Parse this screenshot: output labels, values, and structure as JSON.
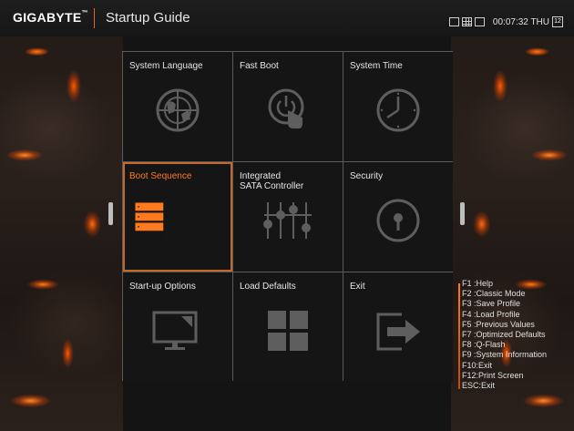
{
  "header": {
    "brand": "GIGABYTE",
    "brand_mark": "™",
    "title": "Startup Guide",
    "time": "00:07:32 THU",
    "calendar_day": "12"
  },
  "tiles": [
    {
      "label": "System Language",
      "icon": "globe-icon"
    },
    {
      "label": "Fast Boot",
      "icon": "power-touch-icon"
    },
    {
      "label": "System Time",
      "icon": "clock-icon"
    },
    {
      "label": "Boot Sequence",
      "icon": "boot-list-icon",
      "selected": true,
      "boot_items": [
        "1",
        "2",
        "3"
      ]
    },
    {
      "label": "Integrated\nSATA Controller",
      "icon": "sliders-icon"
    },
    {
      "label": "Security",
      "icon": "keyhole-icon"
    },
    {
      "label": "Start-up Options",
      "icon": "monitor-icon"
    },
    {
      "label": "Load Defaults",
      "icon": "grid-icon"
    },
    {
      "label": "Exit",
      "icon": "exit-arrow-icon"
    }
  ],
  "hotkeys": [
    "F1 :Help",
    "F2 :Classic Mode",
    "F3 :Save Profile",
    "F4 :Load Profile",
    "F5 :Previous Values",
    "F7 :Optimized Defaults",
    "F8 :Q-Flash",
    "F9 :System Information",
    "F10:Exit",
    "F12:Print Screen",
    "ESC:Exit"
  ],
  "colors": {
    "accent": "#ff7a1f",
    "selected_border": "#c4692a",
    "tile_bg": "#151515",
    "grid_line": "#5a5a5a"
  }
}
